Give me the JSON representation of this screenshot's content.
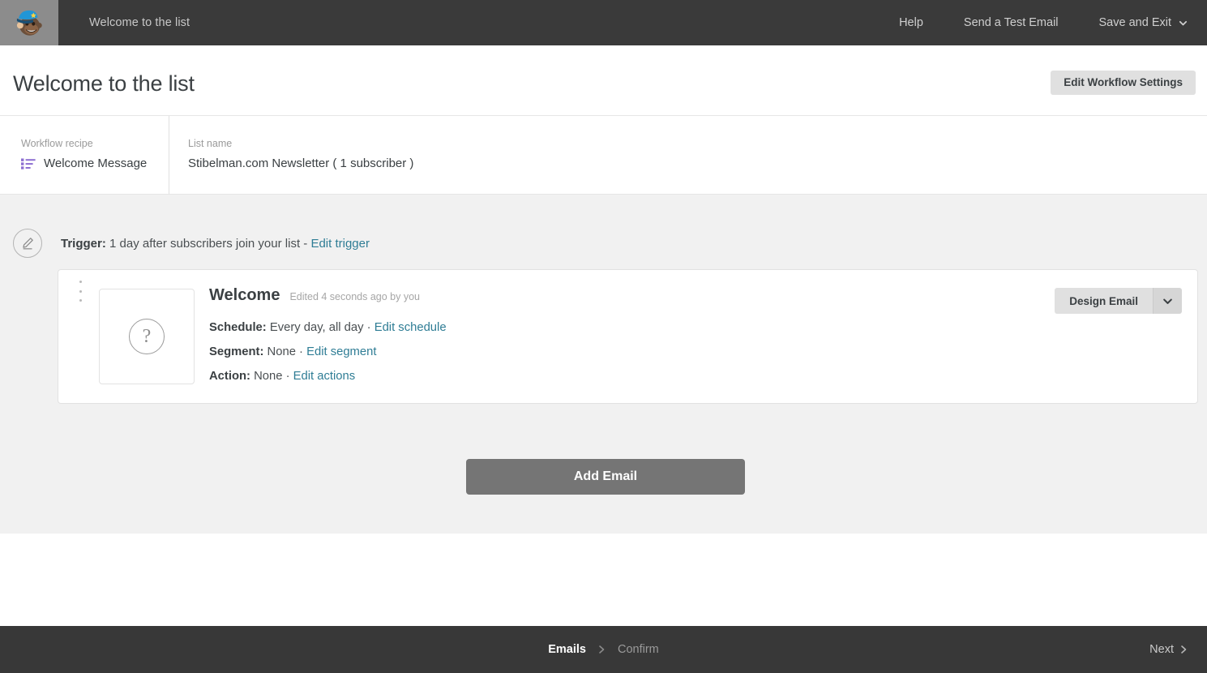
{
  "topbar": {
    "logo_icon": "mailchimp-freddie-logo",
    "title": "Welcome to the list",
    "links": [
      {
        "label": "Help",
        "icon": ""
      },
      {
        "label": "Send a Test Email",
        "icon": ""
      },
      {
        "label": "Save and Exit",
        "icon": "chevron-down-icon"
      }
    ],
    "bg_color": "#3a3a3a",
    "logo_bg_color": "#8c8c8c"
  },
  "page": {
    "title": "Welcome to the list",
    "settings_button": "Edit Workflow Settings"
  },
  "info": {
    "recipe_label": "Workflow recipe",
    "recipe_value": "Welcome Message",
    "recipe_icon": "list-icon",
    "recipe_icon_color": "#8d6fd1",
    "list_label": "List name",
    "list_value": "Stibelman.com Newsletter ( 1 subscriber )"
  },
  "workflow": {
    "trigger_icon": "pencil-circle-icon",
    "trigger_label": "Trigger:",
    "trigger_value": "1 day after subscribers join your list -",
    "trigger_link": "Edit trigger",
    "email": {
      "drag_handle_icon": "drag-dots-icon",
      "thumbnail_icon": "question-mark-icon",
      "title": "Welcome",
      "edited": "Edited 4 seconds ago by you",
      "schedule_label": "Schedule:",
      "schedule_value": "Every day, all day ·",
      "schedule_link": "Edit schedule",
      "segment_label": "Segment:",
      "segment_value": "None ·",
      "segment_link": "Edit segment",
      "action_label": "Action:",
      "action_value": "None ·",
      "action_link": "Edit actions",
      "design_button": "Design Email",
      "design_caret_icon": "chevron-down-icon"
    },
    "add_email_button": "Add Email",
    "canvas_bg_color": "#f1f1f1",
    "link_color": "#2f7d95"
  },
  "footer": {
    "step_current": "Emails",
    "step_separator_icon": "chevron-right-icon",
    "step_next": "Confirm",
    "next_button": "Next",
    "next_icon": "chevron-right-icon",
    "bg_color": "#383838"
  }
}
